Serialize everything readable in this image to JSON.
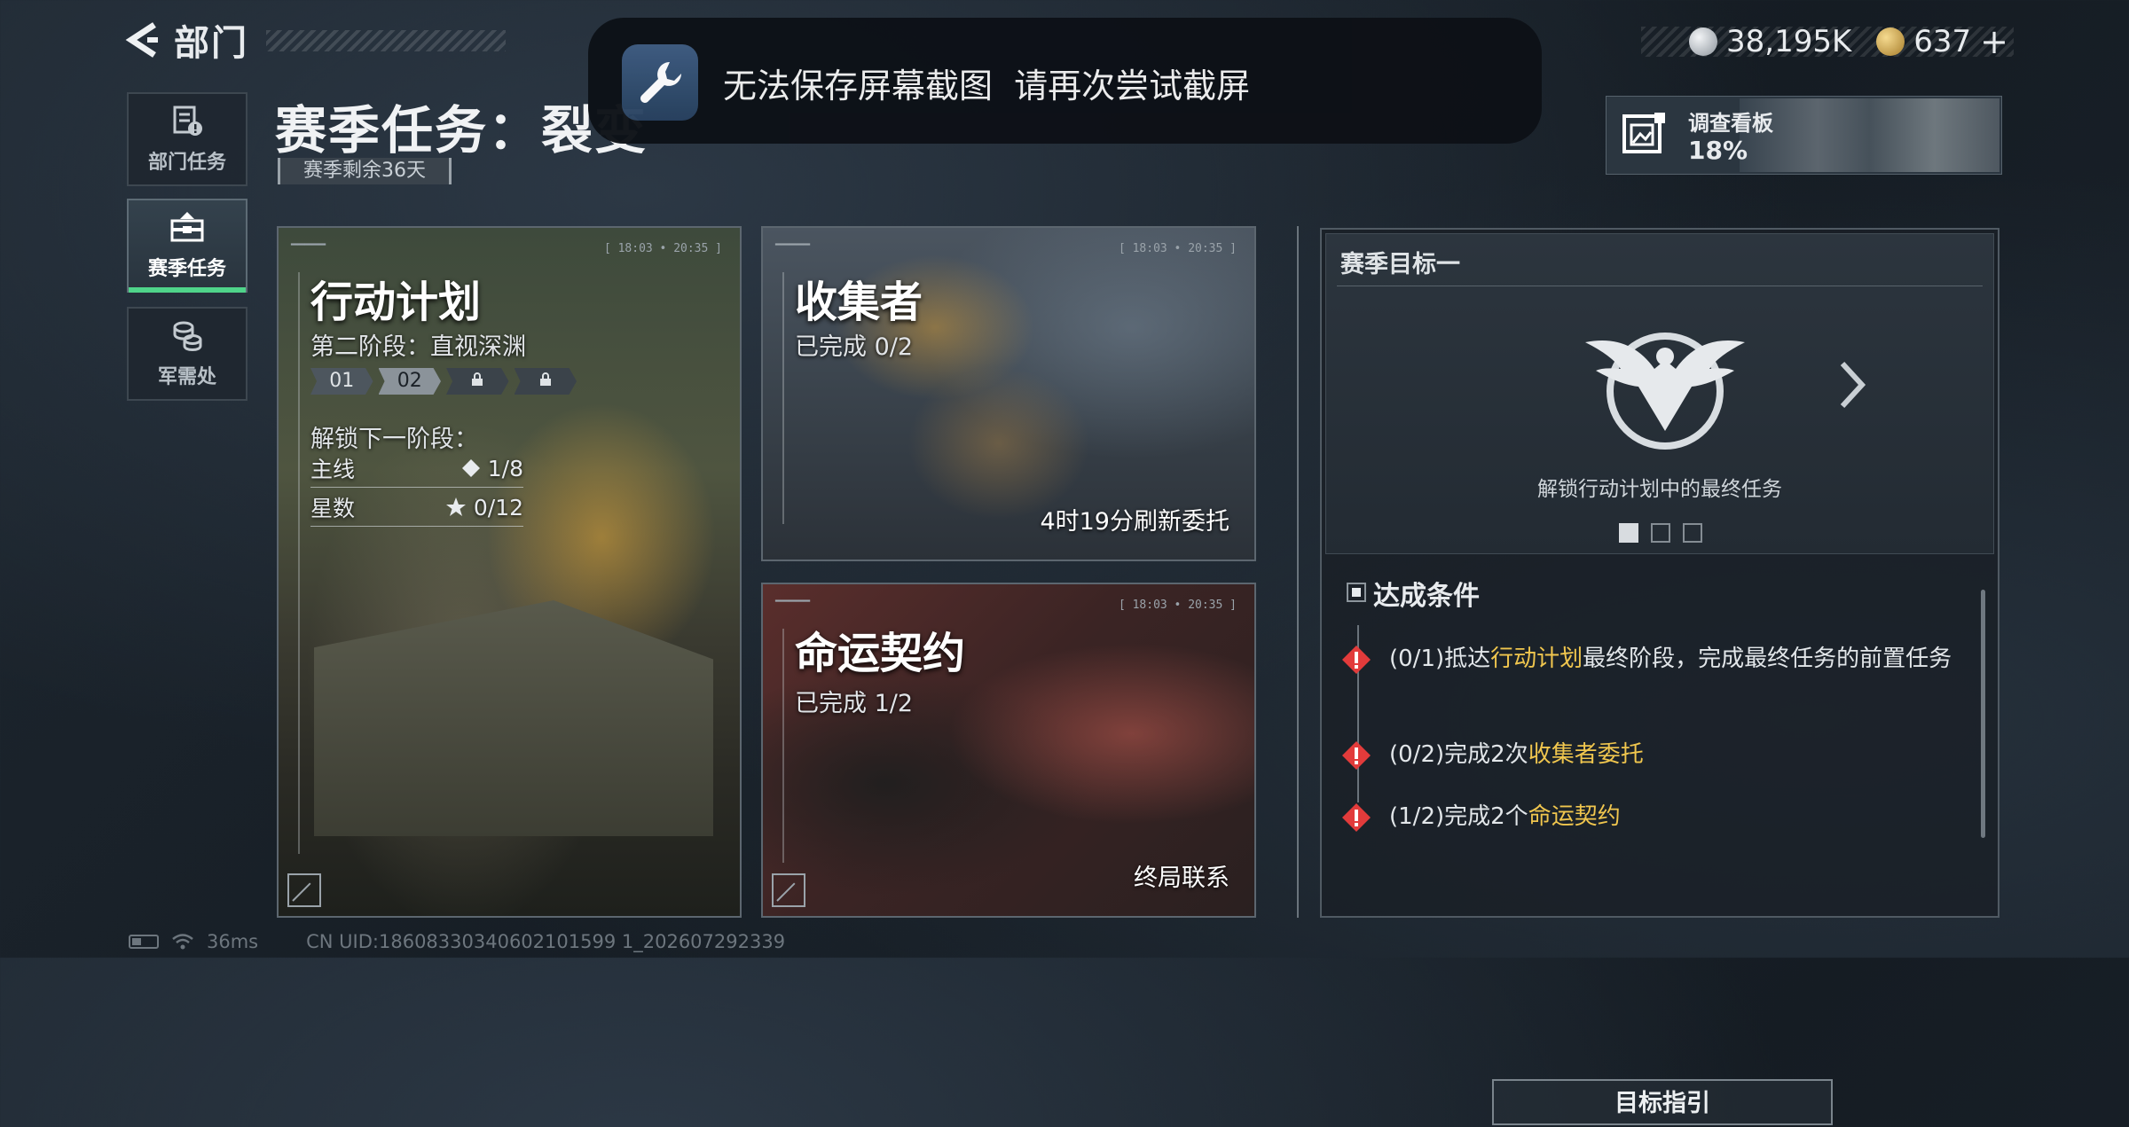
{
  "header": {
    "back_title": "部门"
  },
  "toast": {
    "message": "无法保存屏幕截图  请再次尝试截屏"
  },
  "currency": {
    "silver": "38,195K",
    "gold": "637",
    "add": "+"
  },
  "survey_board": {
    "label": "调查看板",
    "percent": "18%",
    "progress": 0.18
  },
  "sidebar": {
    "items": [
      {
        "label": "部门任务",
        "icon": "document-alert-icon",
        "active": false
      },
      {
        "label": "赛季任务",
        "icon": "briefcase-icon",
        "active": true
      },
      {
        "label": "军需处",
        "icon": "coins-icon",
        "active": false
      }
    ]
  },
  "season": {
    "title": "赛季任务：裂变",
    "remaining": "赛季剩余36天"
  },
  "cards": {
    "action_plan": {
      "title": "行动计划",
      "stage": "第二阶段：直视深渊",
      "stages": [
        "01",
        "02",
        "",
        ""
      ],
      "unlock_label": "解锁下一阶段：",
      "main_label": "主线",
      "main_value": "1/8",
      "star_label": "星数",
      "star_value": "0/12"
    },
    "collector": {
      "title": "收集者",
      "progress": "已完成 0/2",
      "refresh": "4时19分刷新委托"
    },
    "fate_contract": {
      "title": "命运契约",
      "progress": "已完成 1/2",
      "footer": "终局联系"
    }
  },
  "goal_panel": {
    "title": "赛季目标一",
    "description": "解锁行动计划中的最终任务",
    "conditions_title": "达成条件",
    "conditions": [
      {
        "prefix": "(0/1)抵达",
        "highlight": "行动计划",
        "suffix": "最终阶段，完成最终任务的前置任务"
      },
      {
        "prefix": "(0/2)完成2次",
        "highlight": "收集者委托",
        "suffix": ""
      },
      {
        "prefix": "(1/2)完成2个",
        "highlight": "命运契约",
        "suffix": ""
      }
    ],
    "guide_button": "目标指引",
    "page_count": 3,
    "current_page": 1
  },
  "footer": {
    "ping": "36ms",
    "uid": "CN UID:18608330340602101599 1_202607292339"
  },
  "colors": {
    "accent_green": "#4fd48a",
    "highlight_yellow": "#f0c64e",
    "warning_red": "#e23b3b"
  }
}
